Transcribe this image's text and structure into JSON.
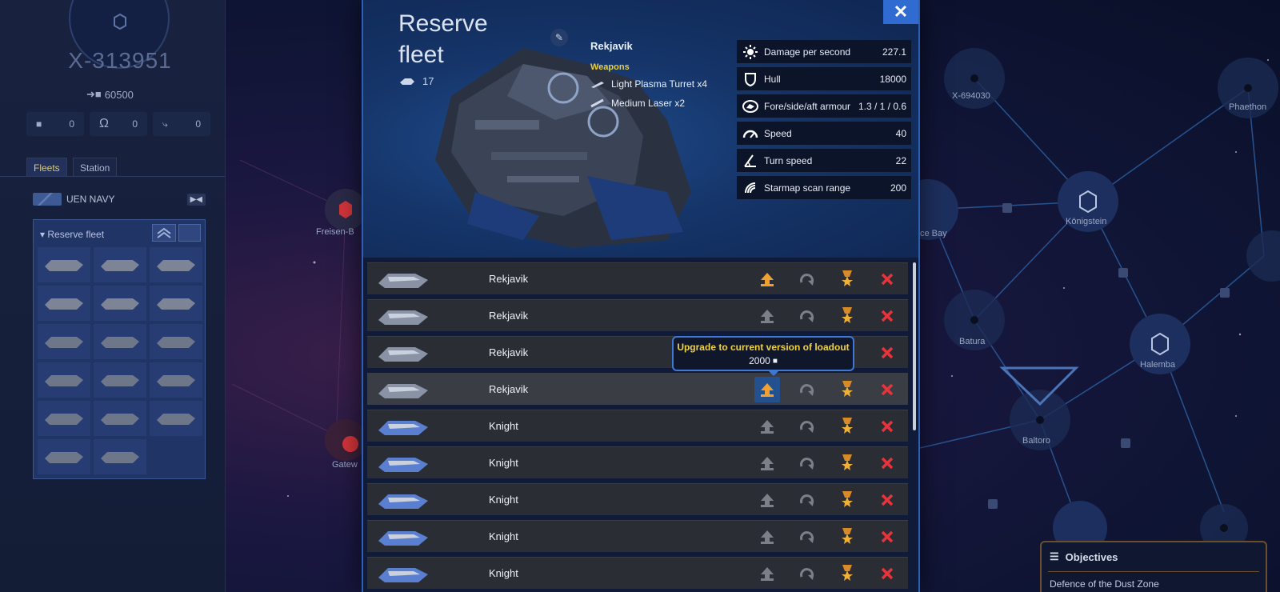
{
  "system": {
    "name": "X-313951",
    "value": "60500"
  },
  "resources": [
    {
      "icon": "cube-icon",
      "value": "0"
    },
    {
      "icon": "omega-icon",
      "value": "0"
    },
    {
      "icon": "drone-icon",
      "value": "0"
    }
  ],
  "tabs": [
    {
      "label": "Fleets"
    },
    {
      "label": "Station"
    }
  ],
  "navy": {
    "label": "UEN NAVY"
  },
  "fleet_box": {
    "title": "▾ Reserve fleet"
  },
  "modal": {
    "title_line1": "Reserve",
    "title_line2": "fleet",
    "ship_count": "17",
    "selected_ship": "Rekjavik",
    "weapons_heading": "Weapons",
    "weapons": [
      {
        "label": "Light Plasma Turret x4"
      },
      {
        "label": "Medium Laser x2"
      }
    ],
    "stats": [
      {
        "label": "Damage per second",
        "value": "227.1",
        "icon": "sun-icon"
      },
      {
        "label": "Hull",
        "value": "18000",
        "icon": "shield-icon"
      },
      {
        "label": "Fore/side/aft armour",
        "value": "1.3 / 1 / 0.6",
        "icon": "armour-icon"
      },
      {
        "label": "Speed",
        "value": "40",
        "icon": "speedometer-icon"
      },
      {
        "label": "Turn speed",
        "value": "22",
        "icon": "angle-icon"
      },
      {
        "label": "Starmap scan range",
        "value": "200",
        "icon": "radar-icon"
      }
    ],
    "ships": [
      {
        "name": "Rekjavik",
        "upgrade_available": true
      },
      {
        "name": "Rekjavik",
        "upgrade_available": false
      },
      {
        "name": "Rekjavik",
        "upgrade_available": false
      },
      {
        "name": "Rekjavik",
        "upgrade_available": true
      },
      {
        "name": "Knight",
        "upgrade_available": false
      },
      {
        "name": "Knight",
        "upgrade_available": false
      },
      {
        "name": "Knight",
        "upgrade_available": false
      },
      {
        "name": "Knight",
        "upgrade_available": false
      },
      {
        "name": "Knight",
        "upgrade_available": false
      }
    ],
    "tooltip": {
      "line1": "Upgrade to current version of loadout",
      "cost": "2000"
    }
  },
  "map": {
    "labels": [
      "X-694030",
      "Phaethon",
      "Königstein",
      "Batura",
      "Halemba",
      "Baltoro",
      "Freisen-B",
      "Gatew",
      "ce Bay"
    ]
  },
  "objectives": {
    "title": "Objectives",
    "item": "Defence of the Dust Zone"
  },
  "colors": {
    "accent": "#2f6bd0",
    "gold": "#e7cf42",
    "danger": "#e8333a",
    "upgrade_orange": "#f0a030"
  }
}
